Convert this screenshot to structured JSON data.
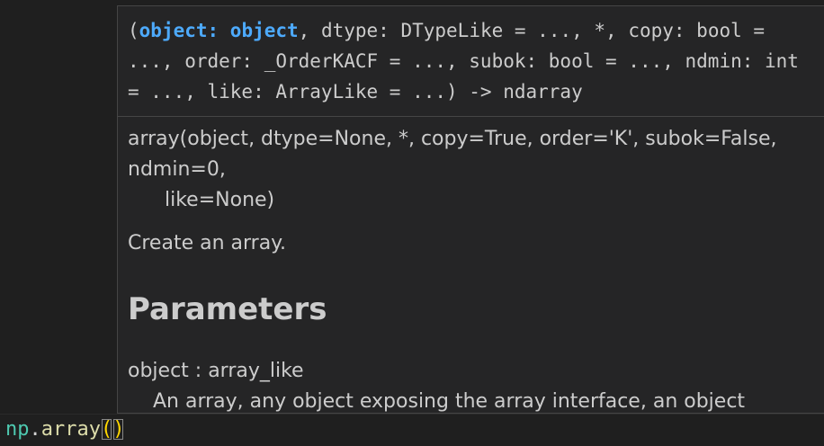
{
  "hover": {
    "signature": {
      "open": "(",
      "active_param": "object: object",
      "rest": ", dtype: DTypeLike = ..., *, copy: bool = ..., order: _OrderKACF = ..., subok: bool = ..., ndmin: int = ..., like: ArrayLike = ...) -> ndarray"
    },
    "doc": {
      "call_line1": "array(object, dtype=None, *, copy=True, order='K', subok=False,",
      "call_line2": "ndmin=0,",
      "call_line3": "like=None)",
      "summary": "Create an array.",
      "section_heading": "Parameters",
      "param_name": "object : array_like",
      "param_desc": "An array, any object exposing the array interface, an object whose"
    }
  },
  "editor": {
    "module": "np",
    "dot": ".",
    "function": "array",
    "open_paren": "(",
    "close_paren": ")"
  },
  "colors": {
    "background": "#1f1f1f",
    "hover_background": "#252526",
    "active_param": "#4daafc",
    "module": "#4ec9b0",
    "function": "#dcdcaa",
    "bracket": "#ffd700"
  }
}
